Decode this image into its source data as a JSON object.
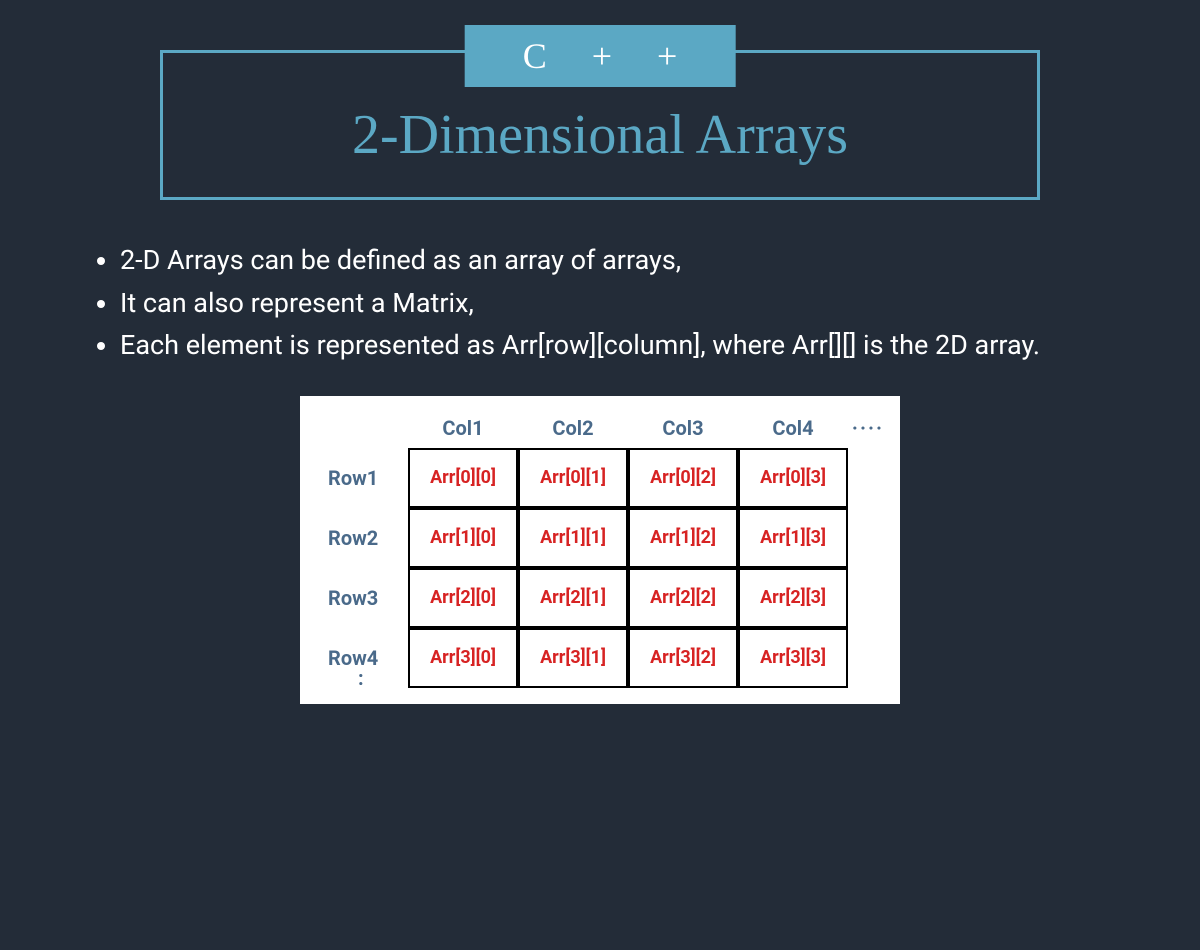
{
  "badge": "C + +",
  "title": "2-Dimensional Arrays",
  "bullets": [
    "2-D Arrays can be defined as an array of arrays,",
    "It can also represent a Matrix,",
    "Each element is represented as Arr[row][column], where Arr[][] is the 2D array."
  ],
  "matrix": {
    "colHeaders": [
      "Col1",
      "Col2",
      "Col3",
      "Col4"
    ],
    "rowHeaders": [
      "Row1",
      "Row2",
      "Row3",
      "Row4"
    ],
    "colDots": "····",
    "rowDots": ":",
    "cells": [
      [
        "Arr[0][0]",
        "Arr[0][1]",
        "Arr[0][2]",
        "Arr[0][3]"
      ],
      [
        "Arr[1][0]",
        "Arr[1][1]",
        "Arr[1][2]",
        "Arr[1][3]"
      ],
      [
        "Arr[2][0]",
        "Arr[2][1]",
        "Arr[2][2]",
        "Arr[2][3]"
      ],
      [
        "Arr[3][0]",
        "Arr[3][1]",
        "Arr[3][2]",
        "Arr[3][3]"
      ]
    ]
  }
}
